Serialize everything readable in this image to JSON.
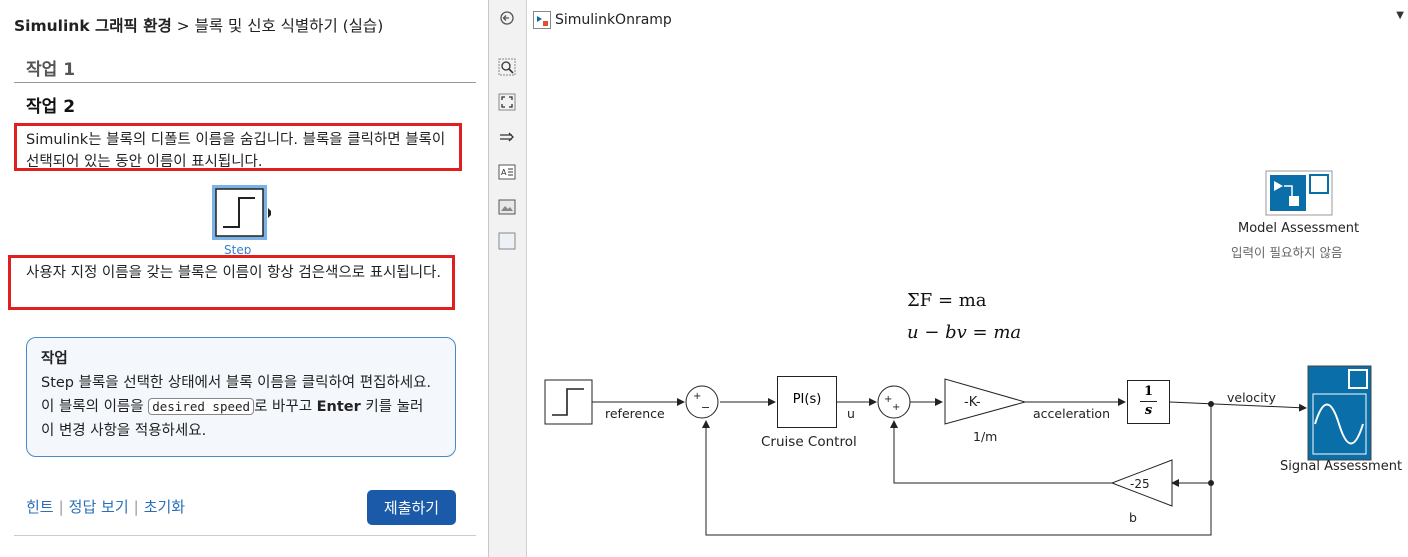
{
  "panel": {
    "breadcrumb_bold": "Simulink 그래픽 환경",
    "breadcrumb_sep": " > ",
    "breadcrumb_rest": "블록 및 신호 식별하기 (실습)",
    "task1": "작업 1",
    "task2": "작업 2",
    "para1": "Simulink는 블록의 디폴트 이름을 숨깁니다. 블록을 클릭하면 블록이 선택되어 있는 동안 이름이 표시됩니다.",
    "step_label": "Step",
    "para2": "사용자 지정 이름을 갖는 블록은 이름이 항상 검은색으로 표시됩니다.",
    "taskbox_title": "작업",
    "taskbox_1": "Step 블록을 선택한 상태에서 블록 이름을 클릭하여 편집하세요. 이 블록의 이름을 ",
    "taskbox_code": "desired speed",
    "taskbox_2": "로 바꾸고 ",
    "taskbox_bold": "Enter",
    "taskbox_3": " 키를 눌러 이 변경 사항을 적용하세요.",
    "link_hint": "힌트",
    "link_answer": "정답 보기",
    "link_reset": "초기화",
    "submit": "제출하기"
  },
  "toolbar": {
    "icons": [
      "back-icon",
      "zoom-icon",
      "fit-view-icon",
      "signal-arrow-icon",
      "annotation-icon",
      "image-icon",
      "area-icon"
    ]
  },
  "model": {
    "tab": "SimulinkOnramp",
    "assessment_title": "Model Assessment",
    "assessment_sub": "입력이 필요하지 않음",
    "eq1": "ΣF = ma",
    "eq2": "u − bv = ma",
    "sig_reference": "reference",
    "pi_block": "PI(s)",
    "pi_name": "Cruise Control",
    "sig_u": "u",
    "gain_block": "-K-",
    "gain_name": "1/m",
    "sig_accel": "acceleration",
    "int_num": "1",
    "int_den": "s",
    "sig_velocity": "velocity",
    "scope_name": "Signal Assessment",
    "fb_gain": "-25",
    "fb_name": "b",
    "plus": "+",
    "minus": "−"
  },
  "colors": {
    "accent": "#1a5aa8",
    "highlight": "#e02020",
    "scope": "#0a6ea8"
  }
}
